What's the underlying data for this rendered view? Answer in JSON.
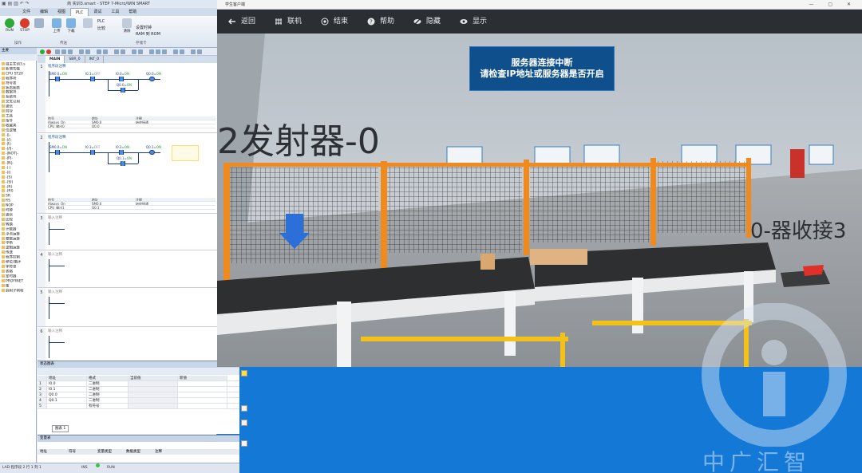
{
  "step7": {
    "title": "商 实训3.smart - STEP 7-Micro/WIN SMART",
    "menu": [
      "文件",
      "编辑",
      "视图",
      "PLC",
      "调试",
      "工具",
      "帮助"
    ],
    "active_menu": "PLC",
    "ribbon": {
      "run": "RUN",
      "stop": "STOP",
      "upload": "上传",
      "download": "下载",
      "plc": "PLC",
      "compare": "比较",
      "erase": "清除",
      "set_clock": "设置时钟",
      "ram_rom": "RAM 到 ROM",
      "group_ops": "操作",
      "group_transfer": "传送",
      "group_mem": "存储卡"
    }
  },
  "tree": {
    "header": "主要",
    "items": [
      "自主实训3.s",
      "新增功能",
      "CPU ST20",
      "程序块",
      "符号表",
      "状态图表",
      "数据块",
      "系统块",
      "交叉引用",
      "通信",
      "向导",
      "工具",
      "指令",
      "收藏夹",
      "位逻辑",
      "-||-",
      "-|/|-",
      "-|I|-",
      "-|/I|-",
      "-|NOT|-",
      "-|P|-",
      "-|N|-",
      "-( )",
      "-(I)",
      "-(S)",
      "-(SI)",
      "-(R)",
      "-(RI)",
      "SR",
      "RS",
      "NOP",
      "时钟",
      "通信",
      "比较",
      "转换",
      "计数器",
      "浮点运算",
      "整数运算",
      "中断",
      "逻辑运算",
      "传送",
      "程序控制",
      "移位/循环",
      "字符串",
      "表格",
      "定时器",
      "PROFINET",
      "库",
      "调用子例程"
    ]
  },
  "editor": {
    "tabs": [
      "MAIN",
      "SBR_0",
      "INT_0"
    ],
    "networks": [
      {
        "num": "1",
        "comment": "程序段注释",
        "contacts": [
          {
            "addr": "SM0.0",
            "state": "ON"
          },
          {
            "addr": "I0.1",
            "state": "OFF"
          },
          {
            "addr": "I0.0",
            "state": "ON"
          }
        ],
        "parallel": {
          "addr": "Q0.0",
          "state": "ON"
        },
        "coil": {
          "addr": "Q0.0",
          "state": "ON"
        },
        "symbols": {
          "headers": [
            "符号",
            "地址",
            "注释"
          ],
          "rows": [
            [
              "Always_On",
              "SM0.0",
              "始终接通"
            ],
            [
              "CPU_输出0",
              "Q0.0",
              ""
            ]
          ]
        }
      },
      {
        "num": "2",
        "comment": "程序段注释",
        "contacts": [
          {
            "addr": "SM0.0",
            "state": "ON"
          },
          {
            "addr": "I0.3",
            "state": "OFF"
          },
          {
            "addr": "I0.2",
            "state": "ON"
          }
        ],
        "parallel": {
          "addr": "Q0.1",
          "state": "ON"
        },
        "coil": {
          "addr": "Q0.1",
          "state": "ON"
        },
        "symbols": {
          "headers": [
            "符号",
            "地址",
            "注释"
          ],
          "rows": [
            [
              "Always_On",
              "SM0.0",
              "始终接通"
            ],
            [
              "CPU_输出1",
              "Q0.1",
              ""
            ]
          ]
        }
      }
    ],
    "empty_networks": [
      {
        "num": "3",
        "comment": "输入注释"
      },
      {
        "num": "4",
        "comment": "输入注释"
      },
      {
        "num": "5",
        "comment": "输入注释"
      },
      {
        "num": "6",
        "comment": "输入注释"
      }
    ]
  },
  "status_chart": {
    "title": "状态图表",
    "headers": [
      "",
      "地址",
      "格式",
      "当前值",
      "新值"
    ],
    "rows": [
      [
        "1",
        "I0.0",
        "二进制",
        "",
        ""
      ],
      [
        "2",
        "I0.1",
        "二进制",
        "",
        ""
      ],
      [
        "3",
        "Q0.0",
        "二进制",
        "",
        ""
      ],
      [
        "4",
        "Q0.1",
        "二进制",
        "",
        ""
      ],
      [
        "5",
        "",
        "有符号",
        "",
        ""
      ]
    ],
    "tab": "图表 1"
  },
  "vars": {
    "title": "变量表",
    "headers": [
      "地址",
      "符号",
      "变量类型",
      "数据类型",
      "注释"
    ]
  },
  "statusbar": {
    "mode": "LAD 程序段 2 行 1 列 1",
    "ins": "INS",
    "run": "RUN"
  },
  "twin": {
    "title": "学生客户端",
    "buttons": [
      "返回",
      "联机",
      "结束",
      "帮助",
      "隐藏",
      "显示"
    ],
    "alert_line1": "服务器连接中断",
    "alert_line2": "请检查IP地址或服务器是否开启",
    "scene_text_emitter": "2发射器-0",
    "scene_text_receiver": "0-器收接3"
  },
  "watermark": {
    "text": "中广汇智"
  }
}
